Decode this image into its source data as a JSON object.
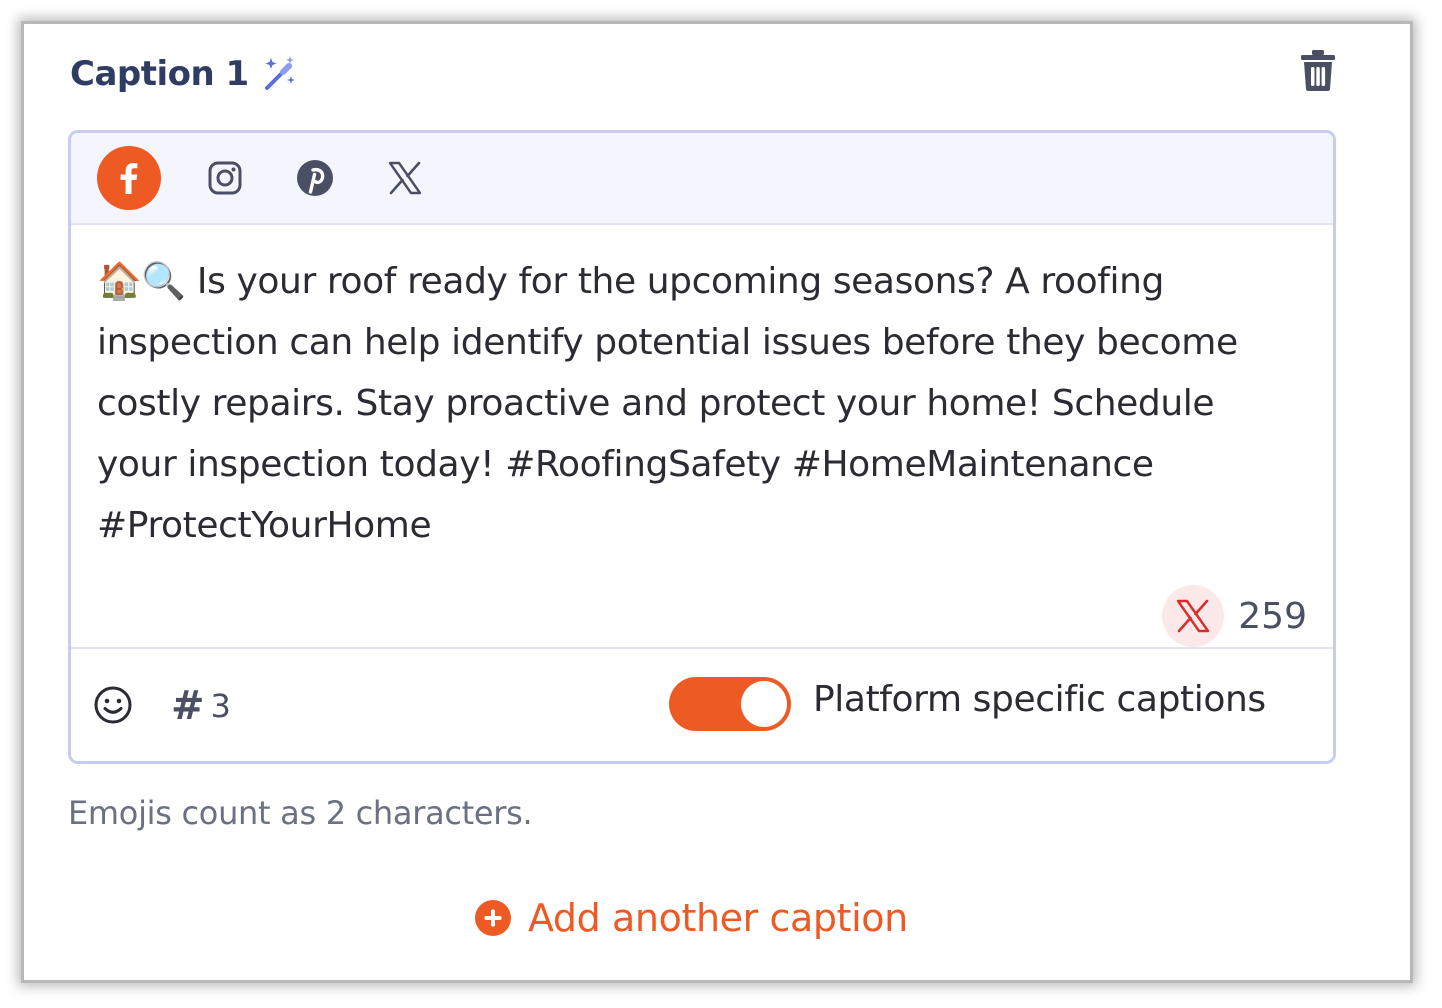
{
  "header": {
    "title": "Caption 1",
    "wand_icon": "magic-wand-icon",
    "delete_icon": "trash-icon"
  },
  "platforms": [
    {
      "name": "Facebook",
      "icon": "facebook-icon",
      "active": true
    },
    {
      "name": "Instagram",
      "icon": "instagram-icon",
      "active": false
    },
    {
      "name": "Pinterest",
      "icon": "pinterest-icon",
      "active": false
    },
    {
      "name": "X",
      "icon": "x-icon",
      "active": false
    }
  ],
  "caption": {
    "text": "🏠🔍 Is your roof ready for the upcoming seasons? A roofing inspection can help identify potential issues before they become costly repairs. Stay proactive and protect your home! Schedule your inspection today! #RoofingSafety #HomeMaintenance #ProtectYourHome"
  },
  "counter": {
    "platform_icon": "x-icon",
    "value": "259"
  },
  "footer": {
    "emoji_icon": "smiley-icon",
    "hashtag_symbol": "#",
    "hashtag_count": "3",
    "toggle_on": true,
    "toggle_label": "Platform specific captions"
  },
  "hint": "Emojis count as 2 characters.",
  "add_caption": {
    "label": "Add another caption",
    "icon": "plus-circle-icon"
  },
  "colors": {
    "accent": "#ee5a24",
    "title": "#2f3d63",
    "border": "#c6cdf0",
    "toolbar_bg": "#f5f6fd",
    "counter_badge_bg": "#fbe9e9"
  }
}
